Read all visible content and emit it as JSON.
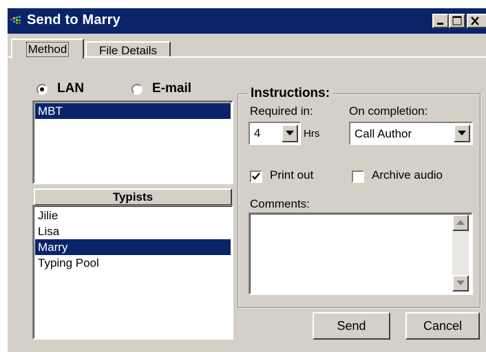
{
  "window": {
    "title": "Send to Marry"
  },
  "tabs": [
    {
      "label": "Method"
    },
    {
      "label": "File Details"
    }
  ],
  "method": {
    "lan_label": "LAN",
    "email_label": "E-mail",
    "selected": "LAN",
    "destinations": [
      {
        "label": "MBT",
        "selected": true
      }
    ],
    "typists_header": "Typists",
    "typists": [
      {
        "label": "Jilie",
        "selected": false
      },
      {
        "label": "Lisa",
        "selected": false
      },
      {
        "label": "Marry",
        "selected": true
      },
      {
        "label": "Typing Pool",
        "selected": false
      }
    ]
  },
  "instructions": {
    "legend": "Instructions:",
    "required_in_label": "Required in:",
    "required_value": "4",
    "hrs_label": "Hrs",
    "on_completion_label": "On completion:",
    "on_completion_value": "Call Author",
    "print_out_label": "Print out",
    "print_out_checked": true,
    "archive_audio_label": "Archive audio",
    "archive_audio_checked": false,
    "comments_label": "Comments:",
    "comments_value": ""
  },
  "buttons": {
    "send": "Send",
    "cancel": "Cancel"
  },
  "colors": {
    "titlebar": "#0a246a",
    "selection": "#0a246a",
    "face": "#d4d0c8"
  }
}
